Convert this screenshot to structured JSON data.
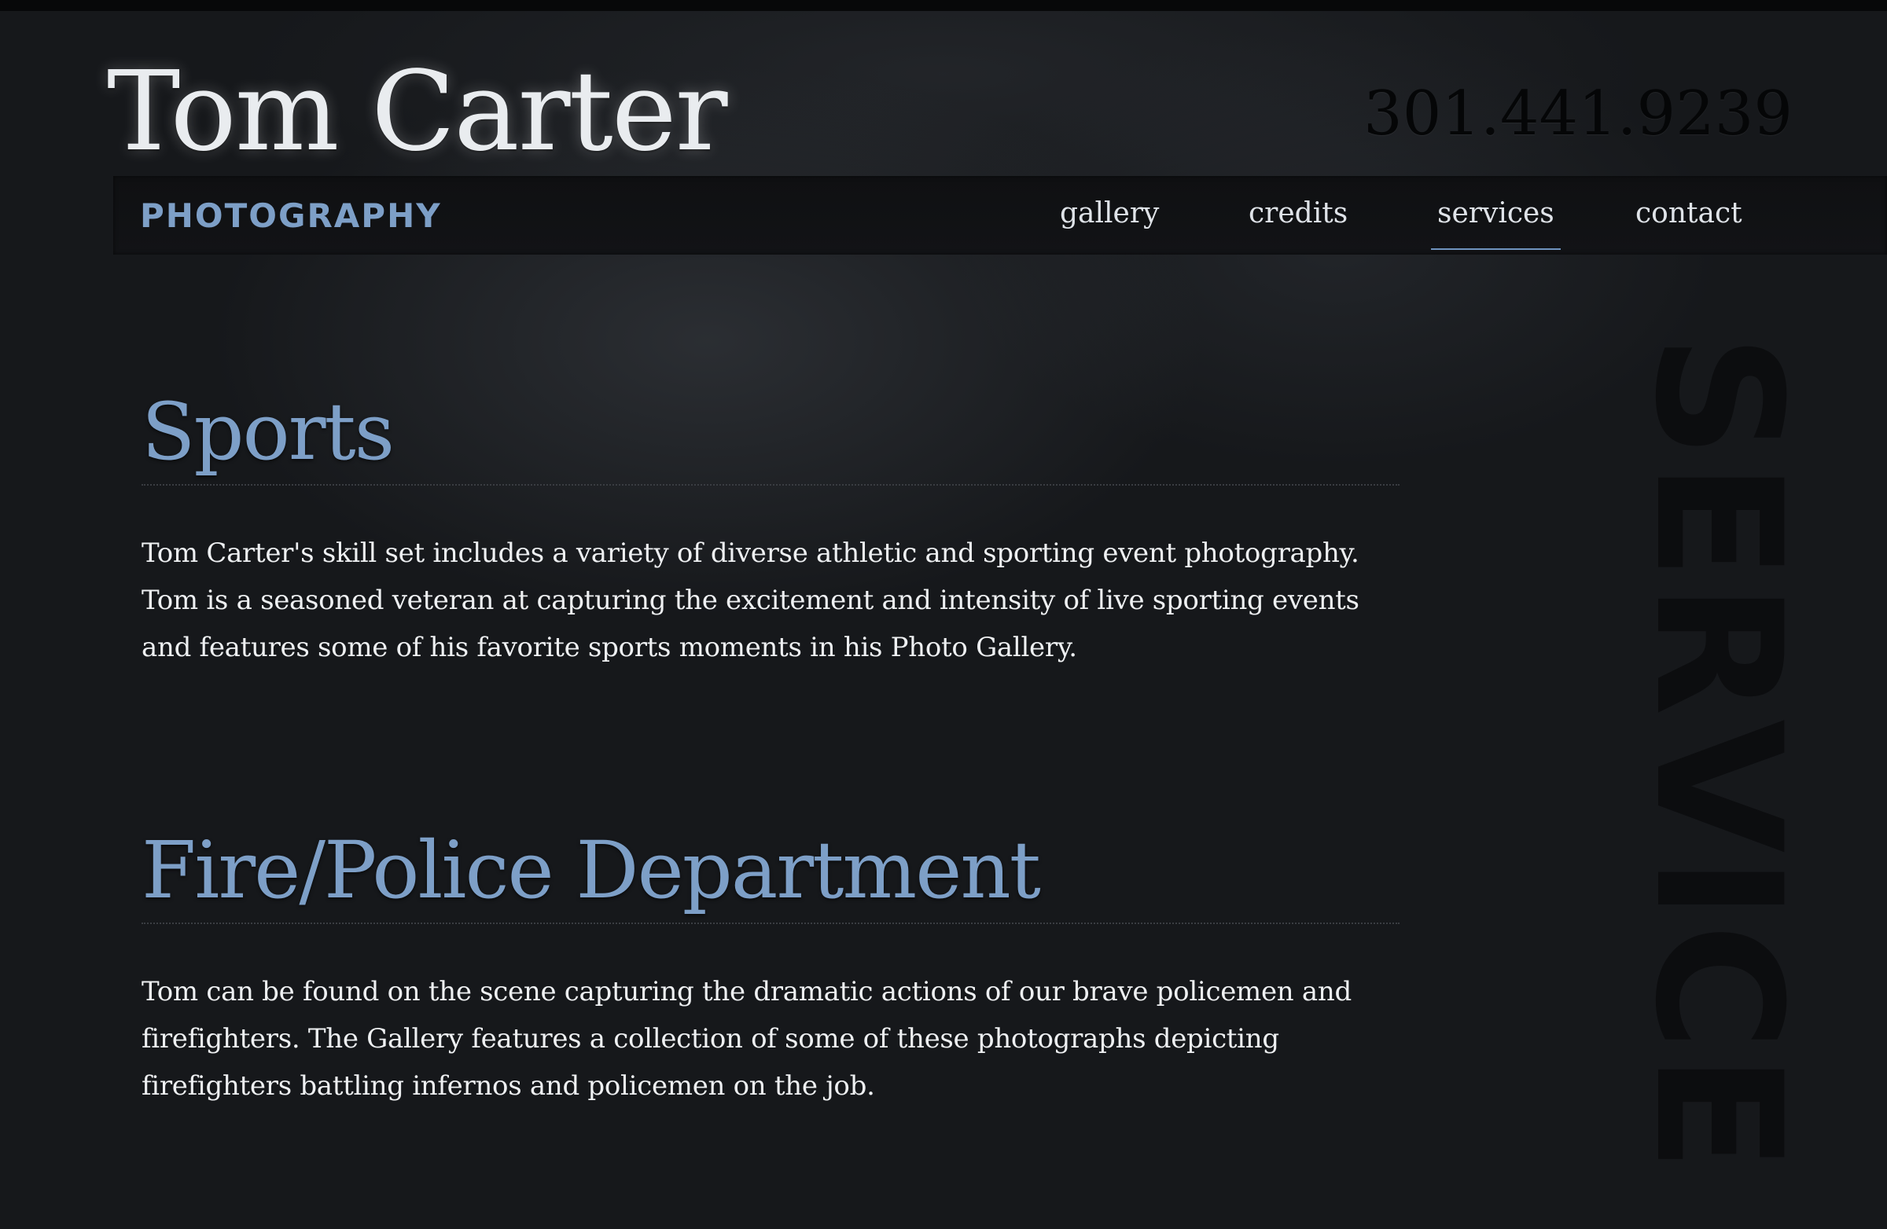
{
  "header": {
    "brand_name": "Tom Carter",
    "subtitle": "PHOTOGRAPHY",
    "phone": "301.441.9239"
  },
  "nav": {
    "items": [
      {
        "label": "gallery",
        "active": false
      },
      {
        "label": "credits",
        "active": false
      },
      {
        "label": "services",
        "active": true
      },
      {
        "label": "contact",
        "active": false
      }
    ]
  },
  "side_word": "SERVICE",
  "sections": [
    {
      "title": "Sports",
      "body": "Tom Carter's skill set includes a variety of diverse athletic and sporting event photography. Tom is a seasoned veteran at capturing the excitement and intensity of live sporting events and features some of his favorite sports moments in his Photo Gallery."
    },
    {
      "title": "Fire/Police Department",
      "body": "Tom can be found on the scene capturing the dramatic actions of our brave policemen and firefighters. The Gallery features a collection of some of these photographs depicting firefighters battling infernos and policemen on the job."
    }
  ],
  "colors": {
    "accent": "#7d9fc7",
    "background": "#16181b",
    "text": "#eef0f2"
  }
}
